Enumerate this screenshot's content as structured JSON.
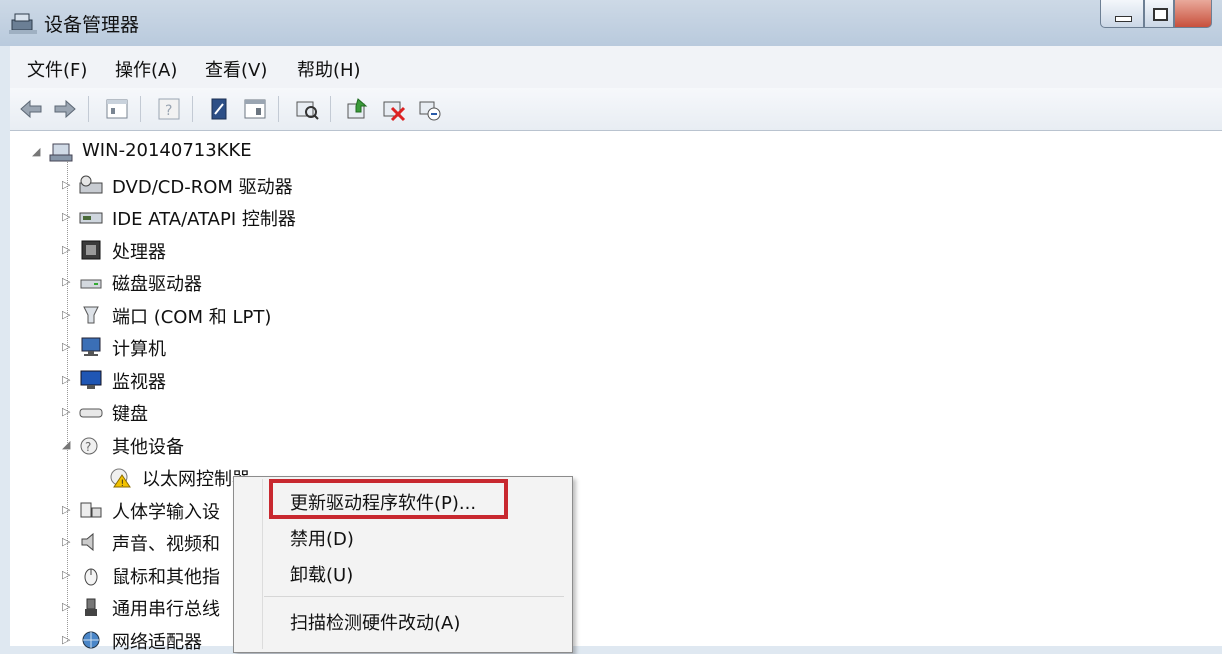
{
  "window": {
    "title": "设备管理器"
  },
  "menu": [
    "文件(F)",
    "操作(A)",
    "查看(V)",
    "帮助(H)"
  ],
  "toolbar_icons": [
    "back-arrow-icon",
    "forward-arrow-icon",
    "properties-icon",
    "help-icon",
    "update-icon",
    "show-hidden-icon",
    "scan-icon",
    "update-driver-icon",
    "disable-icon",
    "uninstall-icon"
  ],
  "tree": {
    "root": "WIN-20140713KKE",
    "items": [
      {
        "label": "DVD/CD-ROM 驱动器",
        "icon": "dvd-drive-icon",
        "expanded": false
      },
      {
        "label": "IDE ATA/ATAPI 控制器",
        "icon": "ide-controller-icon",
        "expanded": false
      },
      {
        "label": "处理器",
        "icon": "processor-icon",
        "expanded": false
      },
      {
        "label": "磁盘驱动器",
        "icon": "disk-drive-icon",
        "expanded": false
      },
      {
        "label": "端口 (COM 和 LPT)",
        "icon": "port-icon",
        "expanded": false
      },
      {
        "label": "计算机",
        "icon": "computer-icon",
        "expanded": false
      },
      {
        "label": "监视器",
        "icon": "monitor-icon",
        "expanded": false
      },
      {
        "label": "键盘",
        "icon": "keyboard-icon",
        "expanded": false
      },
      {
        "label": "其他设备",
        "icon": "other-devices-icon",
        "expanded": true
      },
      {
        "label": "人体学输入设",
        "icon": "hid-icon",
        "expanded": false
      },
      {
        "label": "声音、视频和",
        "icon": "sound-icon",
        "expanded": false
      },
      {
        "label": "鼠标和其他指",
        "icon": "mouse-icon",
        "expanded": false
      },
      {
        "label": "通用串行总线",
        "icon": "usb-icon",
        "expanded": false
      },
      {
        "label": "网络适配器",
        "icon": "network-adapter-icon",
        "expanded": false
      }
    ],
    "child": {
      "label": "以太网控制器",
      "icon": "ethernet-warning-icon"
    }
  },
  "context_menu": {
    "items": [
      "更新驱动程序软件(P)...",
      "禁用(D)",
      "卸载(U)",
      "扫描检测硬件改动(A)"
    ]
  },
  "colors": {
    "highlight": "#c8282f"
  }
}
